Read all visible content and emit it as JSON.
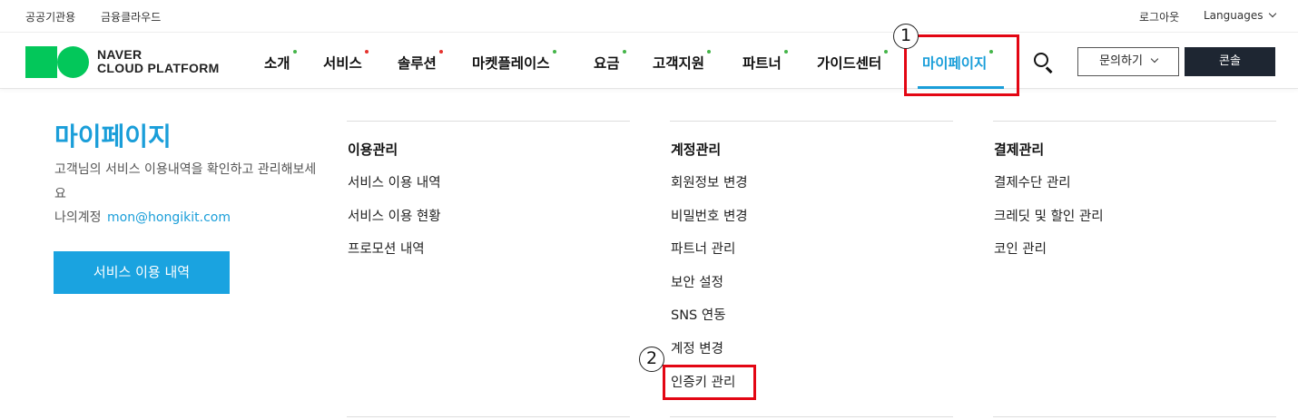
{
  "topbar": {
    "links": [
      "공공기관용",
      "금융클라우드"
    ],
    "logout": "로그아웃",
    "languages": "Languages"
  },
  "logo": {
    "line1": "NAVER",
    "line2": "CLOUD PLATFORM",
    "color": "#03c75a"
  },
  "nav": {
    "items": [
      {
        "label": "소개",
        "dot": "#44b549"
      },
      {
        "label": "서비스",
        "dot": "#e5322d"
      },
      {
        "label": "솔루션",
        "dot": "#e5322d"
      },
      {
        "label": "마켓플레이스",
        "dot": "#44b549"
      },
      {
        "label": "요금",
        "dot": "#44b549"
      },
      {
        "label": "고객지원",
        "dot": "#44b549"
      },
      {
        "label": "파트너",
        "dot": "#44b549"
      },
      {
        "label": "가이드센터",
        "dot": "#44b549"
      },
      {
        "label": "마이페이지",
        "dot": "#44b549",
        "active": true
      }
    ],
    "search_icon": "search-icon",
    "inquiry": "문의하기",
    "console": "콘솔",
    "accent": "#1a9ed9"
  },
  "intro": {
    "title": "마이페이지",
    "desc": "고객님의 서비스 이용내역을 확인하고 관리해보세요",
    "account_label": "나의계정",
    "email": "mon@hongikit.com",
    "button": "서비스 이용 내역"
  },
  "columns": [
    {
      "title": "이용관리",
      "items": [
        "서비스 이용 내역",
        "서비스 이용 현황",
        "프로모션 내역"
      ]
    },
    {
      "title": "계정관리",
      "items": [
        "회원정보 변경",
        "비밀번호 변경",
        "파트너 관리",
        "보안 설정",
        "SNS 연동",
        "계정 변경",
        "인증키 관리"
      ]
    },
    {
      "title": "결제관리",
      "items": [
        "결제수단 관리",
        "크레딧 및 할인 관리",
        "코인 관리"
      ]
    }
  ],
  "annotations": {
    "step1": "1",
    "step2": "2",
    "color": "#e30613"
  }
}
